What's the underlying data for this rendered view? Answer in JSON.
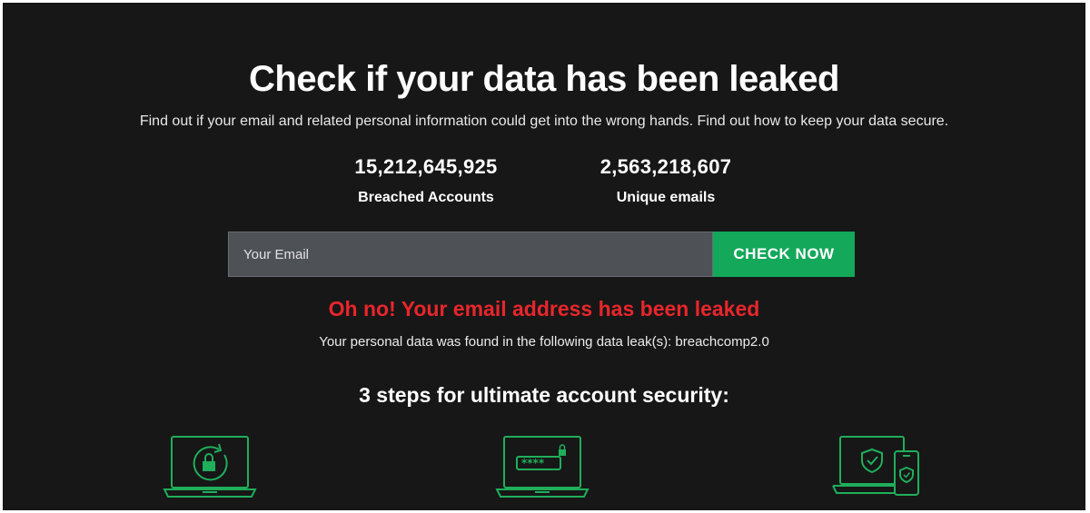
{
  "hero": {
    "title": "Check if your data has been leaked",
    "subtitle": "Find out if your email and related personal information could get into the wrong hands. Find out how to keep your data secure."
  },
  "stats": [
    {
      "value": "15,212,645,925",
      "label": "Breached Accounts"
    },
    {
      "value": "2,563,218,607",
      "label": "Unique emails"
    }
  ],
  "search": {
    "placeholder": "Your Email",
    "button_label": "CHECK NOW"
  },
  "result": {
    "alert": "Oh no! Your email address has been leaked",
    "details": "Your personal data was found in the following data leak(s): breachcomp2.0"
  },
  "steps": {
    "title": "3 steps for ultimate account security:",
    "icons": [
      "laptop-lock-refresh-icon",
      "laptop-password-icon",
      "laptop-phone-shield-icon"
    ]
  },
  "colors": {
    "background": "#171717",
    "accent_green": "#13a85a",
    "alert_red": "#e8262b",
    "icon_green": "#1fae5b"
  }
}
